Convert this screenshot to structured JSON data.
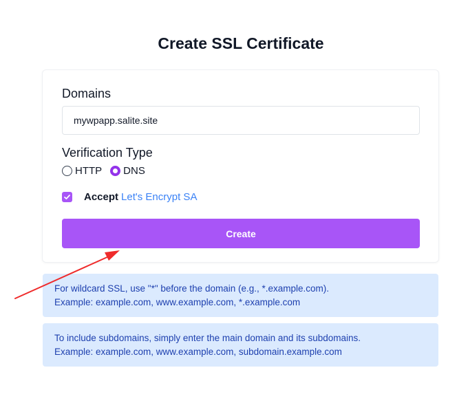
{
  "page": {
    "title": "Create SSL Certificate"
  },
  "form": {
    "domains_label": "Domains",
    "domain_value": "mywpapp.salite.site",
    "verification_label": "Verification Type",
    "verification_options": [
      {
        "label": "HTTP",
        "selected": false
      },
      {
        "label": "DNS",
        "selected": true
      }
    ],
    "accept_checked": true,
    "accept_text": "Accept",
    "accept_link": "Let's Encrypt SA",
    "create_label": "Create"
  },
  "info": {
    "wildcard_line1": "For wildcard SSL, use \"*\" before the domain (e.g., *.example.com).",
    "wildcard_line2": "Example: example.com, www.example.com, *.example.com",
    "subdomain_line1": "To include subdomains, simply enter the main domain and its subdomains.",
    "subdomain_line2": "Example: example.com, www.example.com, subdomain.example.com"
  },
  "annotation": {
    "arrow_color": "#ef2b2b"
  },
  "colors": {
    "accent": "#a855f7",
    "link": "#3b82f6",
    "info_bg": "#dbeafe",
    "info_text": "#1e40af"
  }
}
